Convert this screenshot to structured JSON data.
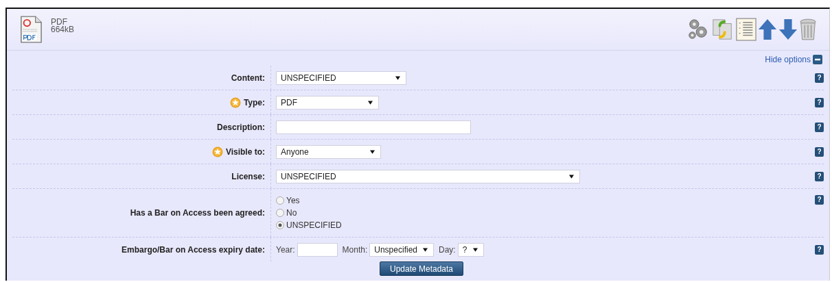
{
  "file": {
    "format": "PDF",
    "size": "664kB"
  },
  "options_toggle": {
    "label": "Hide options",
    "expanded": true
  },
  "fields": [
    {
      "kind": "select",
      "label": "Content:",
      "required": false,
      "value": "UNSPECIFIED",
      "help": "?"
    },
    {
      "kind": "select",
      "label": "Type:",
      "required": true,
      "value": "PDF",
      "help": "?"
    },
    {
      "kind": "text",
      "label": "Description:",
      "required": false,
      "help": "?"
    },
    {
      "kind": "select",
      "label": "Visible to:",
      "required": true,
      "value": "Anyone",
      "help": "?"
    },
    {
      "kind": "select",
      "label": "License:",
      "required": false,
      "value": "UNSPECIFIED",
      "help": "?"
    },
    {
      "kind": "radio",
      "label": "Has a Bar on Access been agreed:",
      "required": false,
      "help": "?",
      "options": [
        {
          "label": "Yes",
          "selected": false
        },
        {
          "label": "No",
          "selected": false
        },
        {
          "label": "UNSPECIFIED",
          "selected": true
        }
      ]
    },
    {
      "kind": "date",
      "label": "Embargo/Bar on Access expiry date:",
      "required": false,
      "help": "?",
      "year_label": "Year:",
      "month_label": "Month:",
      "month": "Unspecified",
      "day_label": "Day:",
      "day": "?"
    }
  ],
  "submit": {
    "label": "Update Metadata"
  }
}
